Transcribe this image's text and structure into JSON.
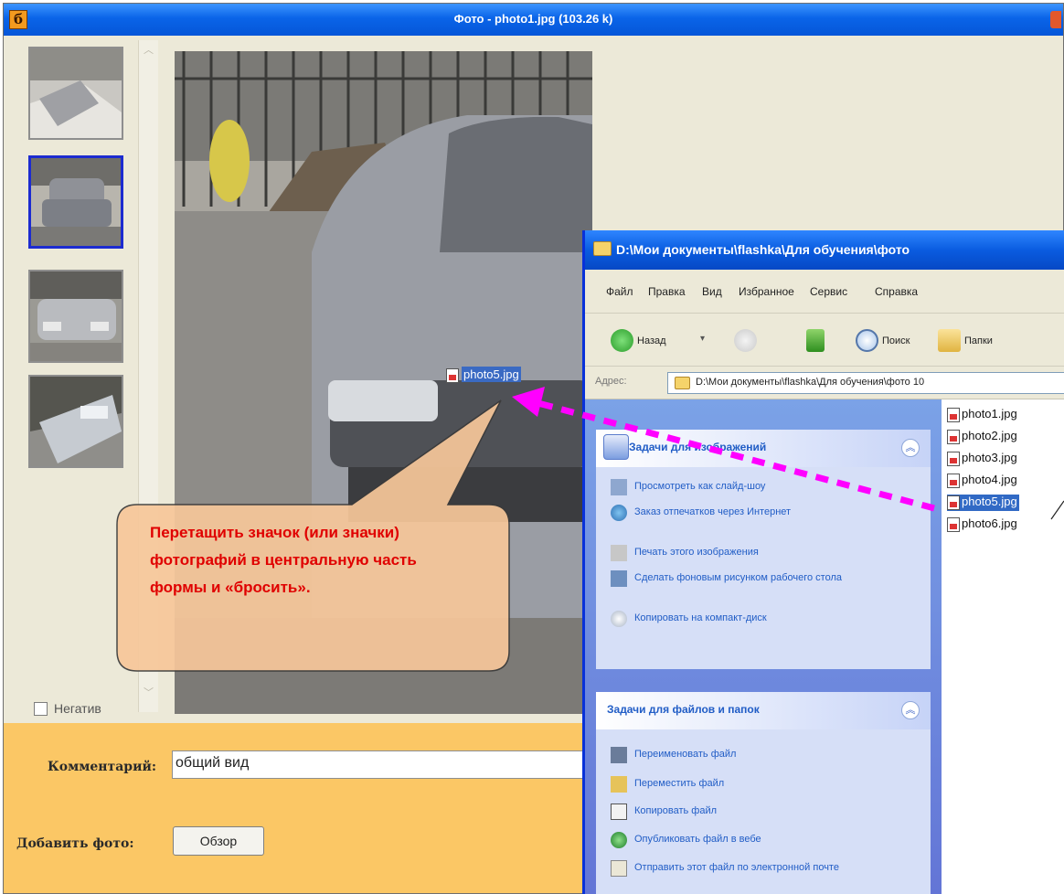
{
  "main_window": {
    "title": "Фото - photo1.jpg (103.26 k)",
    "app_icon_glyph": "б",
    "negative_label": "Негатив",
    "comment_label": "Комментарий:",
    "comment_value": "общий вид",
    "add_photo_label": "Добавить фото:",
    "browse_button": "Обзор",
    "thumbnails": [
      "photo-thumb-1",
      "photo-thumb-2",
      "photo-thumb-3",
      "photo-thumb-4"
    ],
    "selected_thumbnail": 2
  },
  "explorer": {
    "title": "D:\\Мои документы\\flashka\\Для обучения\\фото",
    "menu": [
      "Файл",
      "Правка",
      "Вид",
      "Избранное",
      "Сервис",
      "Справка"
    ],
    "toolbar": {
      "back": "Назад",
      "search": "Поиск",
      "folders": "Папки"
    },
    "address_label": "Адрес:",
    "address_value": "D:\\Мои документы\\flashka\\Для обучения\\фото 10",
    "image_tasks": {
      "header": "Задачи для изображений",
      "items": [
        "Просмотреть как слайд-шоу",
        "Заказ отпечатков через Интернет",
        "Печать этого изображения",
        "Сделать фоновым рисунком рабочего стола",
        "Копировать на компакт-диск"
      ]
    },
    "file_tasks": {
      "header": "Задачи для файлов и папок",
      "items": [
        "Переименовать файл",
        "Переместить файл",
        "Копировать файл",
        "Опубликовать файл в вебе",
        "Отправить этот файл по электронной почте"
      ]
    },
    "files": [
      "photo1.jpg",
      "photo2.jpg",
      "photo3.jpg",
      "photo4.jpg",
      "photo5.jpg",
      "photo6.jpg"
    ],
    "selected_file": "photo5.jpg"
  },
  "drag_item_label": "photo5.jpg",
  "callout_text": "Перетащить значок (или значки) фотографий в центральную часть формы и «бросить».",
  "colors": {
    "callout_text": "#e00000",
    "drag_arrow": "#ff00ff",
    "bottom_panel": "#fbc765",
    "xp_title_blue": "#0a5ce0"
  }
}
